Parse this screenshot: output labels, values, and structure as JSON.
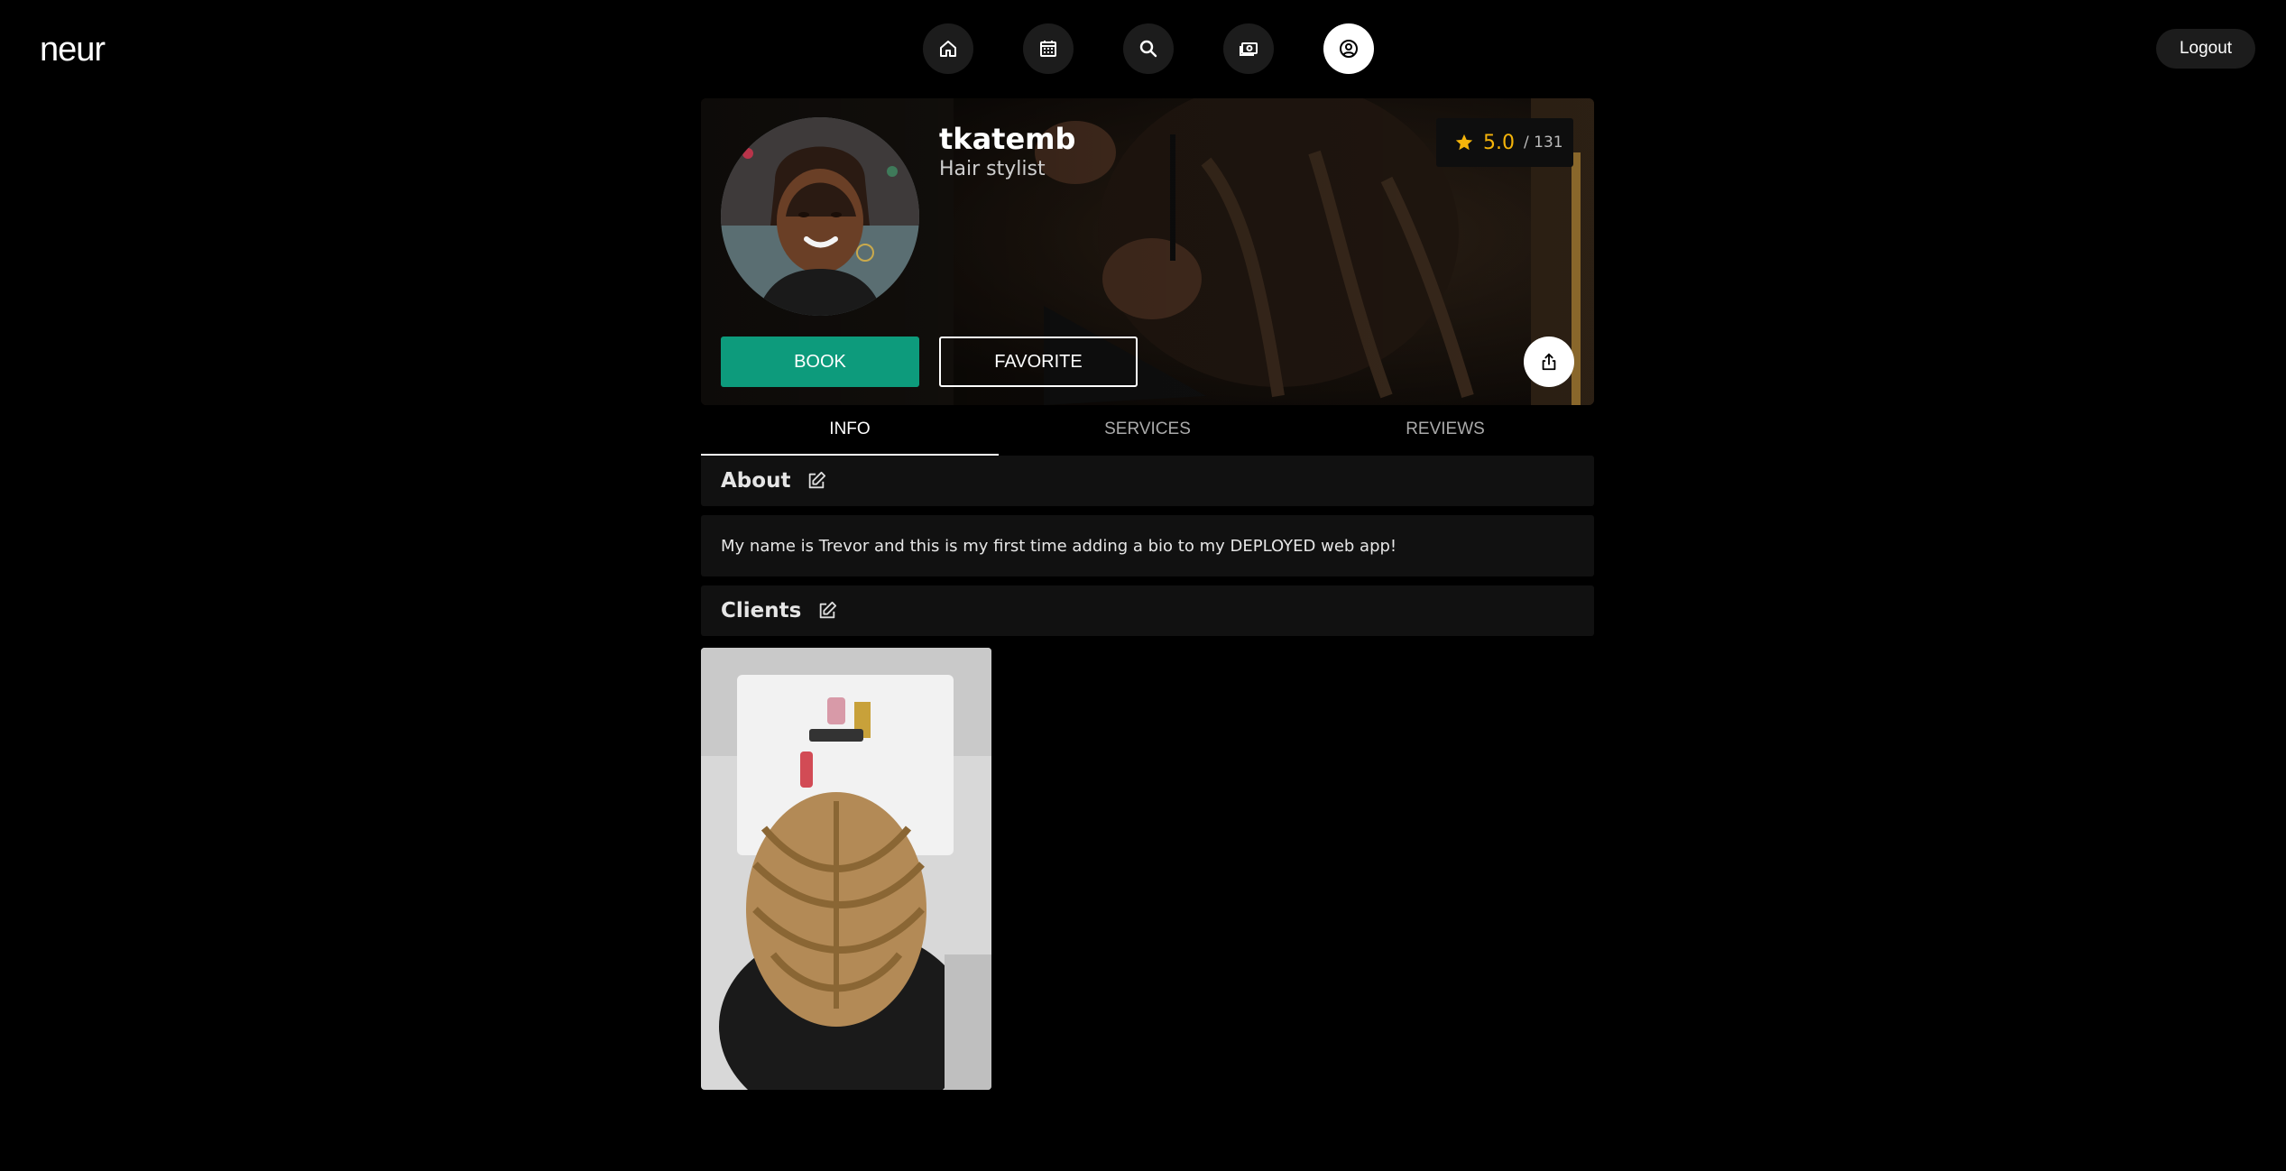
{
  "app": {
    "logo": "neur",
    "logout_label": "Logout"
  },
  "nav": [
    {
      "icon": "home-icon",
      "active": false
    },
    {
      "icon": "calendar-icon",
      "active": false
    },
    {
      "icon": "search-icon",
      "active": false
    },
    {
      "icon": "money-icon",
      "active": false
    },
    {
      "icon": "user-circle-icon",
      "active": true
    }
  ],
  "profile": {
    "username": "tkatemb",
    "role": "Hair stylist",
    "rating": "5.0",
    "rating_count": "/ 131",
    "book_label": "BOOK",
    "favorite_label": "FAVORITE"
  },
  "tabs": [
    {
      "label": "INFO",
      "active": true
    },
    {
      "label": "SERVICES",
      "active": false
    },
    {
      "label": "REVIEWS",
      "active": false
    }
  ],
  "about": {
    "title": "About",
    "bio": "My name is Trevor and this is my first time adding a bio to my DEPLOYED web app!"
  },
  "clients": {
    "title": "Clients"
  },
  "colors": {
    "accent": "#0d9b7c",
    "star": "#f5b40a",
    "background": "#000000"
  }
}
